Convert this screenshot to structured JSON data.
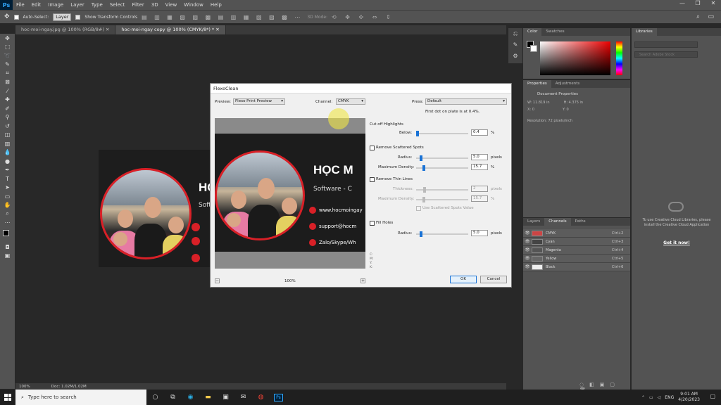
{
  "app": {
    "logo": "Ps"
  },
  "menu": [
    "File",
    "Edit",
    "Image",
    "Layer",
    "Type",
    "Select",
    "Filter",
    "3D",
    "View",
    "Window",
    "Help"
  ],
  "window_controls": [
    "—",
    "❐",
    "✕"
  ],
  "options": {
    "auto_select_label": "Auto-Select:",
    "auto_select_value": "Layer",
    "transform_label": "Show Transform Controls",
    "mode_label": "3D Mode:"
  },
  "tabs": [
    {
      "label": "hoc-moi-ngay.jpg @ 100% (RGB/8#)",
      "close": "✕"
    },
    {
      "label": "hoc-moi-ngay copy @ 100% (CMYK/8*) *",
      "close": "✕"
    }
  ],
  "status": {
    "zoom": "100%",
    "doc": "Doc: 1.02M/1.02M"
  },
  "doc": {
    "brand": "HỌC M",
    "brand2": "Software - C",
    "web": "www.hocmoingay",
    "email": "support@hocm",
    "social": "Zalo/Skype/Wh"
  },
  "dialog": {
    "title": "FlexoClean",
    "preview_label": "Preview:",
    "preview_value": "Flexo Print Preview",
    "channel_label": "Channel:",
    "channel_value": "CMYK",
    "press_label": "Press:",
    "press_value": "Default",
    "first_dot": "First dot on plate is at 0.4%.",
    "cut_off": "Cut off Highlights",
    "below_label": "Below:",
    "below_value": "0.4",
    "below_unit": "%",
    "remove_scattered": "Remove Scattered Spots",
    "radius_label": "Radius:",
    "radius_value": "5.0",
    "radius_unit": "pixels",
    "max_density_label": "Maximum Density:",
    "max_density_value": "15.7",
    "pct": "%",
    "remove_thin": "Remove Thin Lines",
    "thickness_label": "Thickness:",
    "thickness_value": "2",
    "thin_density_value": "15.7",
    "use_scattered": "Use Scattered Spots Value",
    "fill_holes": "Fill Holes",
    "fill_radius_value": "5.0",
    "zoom": "100%",
    "minus": "−",
    "plus": "+",
    "ok": "OK",
    "cancel": "Cancel",
    "readout_c": "C:",
    "readout_m": "M:",
    "readout_y": "Y:",
    "readout_k": "K:"
  },
  "color_panel": {
    "tabs": [
      "Color",
      "Swatches"
    ]
  },
  "properties": {
    "tabs": [
      "Properties",
      "Adjustments"
    ],
    "heading": "Document Properties",
    "w": "W:  11.819 in",
    "h": "H:  4.375 in",
    "x": "X:  0",
    "y": "Y:  0",
    "resolution": "Resolution: 72 pixels/inch"
  },
  "layers": {
    "tabs": [
      "Layers",
      "Channels",
      "Paths"
    ],
    "channels": [
      {
        "name": "CMYK",
        "shortcut": "Ctrl+2"
      },
      {
        "name": "Cyan",
        "shortcut": "Ctrl+3"
      },
      {
        "name": "Magenta",
        "shortcut": "Ctrl+4"
      },
      {
        "name": "Yellow",
        "shortcut": "Ctrl+5"
      },
      {
        "name": "Black",
        "shortcut": "Ctrl+6"
      }
    ]
  },
  "libraries": {
    "tab": "Libraries",
    "search_placeholder": "Search Adobe Stock",
    "message": "To use Creative Cloud Libraries, please install the Creative Cloud Application",
    "link": "Get it now!"
  },
  "taskbar": {
    "search_placeholder": "Type here to search",
    "time": "9:01 AM",
    "date": "4/20/2023",
    "lang": "ENG"
  },
  "colors": {
    "accent": "#1a73d6",
    "brand_red": "#d92027",
    "ui_dark": "#535353"
  }
}
